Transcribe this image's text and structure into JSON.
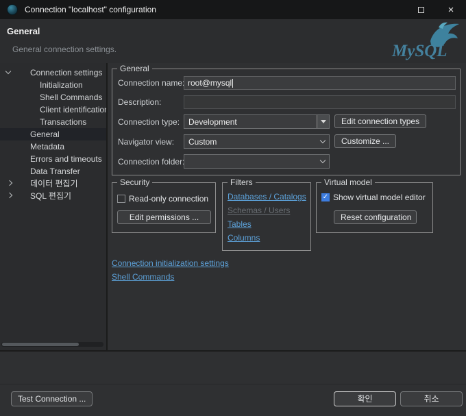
{
  "window": {
    "title": "Connection \"localhost\" configuration"
  },
  "header": {
    "title": "General",
    "subtitle": "General connection settings.",
    "logo_text": "MySQL"
  },
  "sidebar": {
    "items": [
      {
        "label": "Connection settings",
        "level": 0,
        "expanded": true
      },
      {
        "label": "Initialization",
        "level": 1
      },
      {
        "label": "Shell Commands",
        "level": 1
      },
      {
        "label": "Client identification",
        "level": 1
      },
      {
        "label": "Transactions",
        "level": 1
      },
      {
        "label": "General",
        "level": 0,
        "selected": true
      },
      {
        "label": "Metadata",
        "level": 0
      },
      {
        "label": "Errors and timeouts",
        "level": 0
      },
      {
        "label": "Data Transfer",
        "level": 0
      },
      {
        "label": "데이터 편집기",
        "level": 0,
        "collapsed": true
      },
      {
        "label": "SQL 편집기",
        "level": 0,
        "collapsed": true
      }
    ]
  },
  "general_group": {
    "title": "General",
    "connection_name_label": "Connection name:",
    "connection_name_value": "root@mysql",
    "description_label": "Description:",
    "description_value": "",
    "connection_type_label": "Connection type:",
    "connection_type_value": "Development",
    "edit_connection_types_button": "Edit connection types",
    "navigator_view_label": "Navigator view:",
    "navigator_view_value": "Custom",
    "customize_button": "Customize ...",
    "connection_folder_label": "Connection folder:",
    "connection_folder_value": ""
  },
  "security_group": {
    "title": "Security",
    "readonly_label": "Read-only connection",
    "readonly_checked": false,
    "edit_permissions_button": "Edit permissions ..."
  },
  "filters_group": {
    "title": "Filters",
    "links": [
      {
        "label": "Databases / Catalogs",
        "enabled": true
      },
      {
        "label": "Schemas / Users",
        "enabled": false
      },
      {
        "label": "Tables",
        "enabled": true
      },
      {
        "label": "Columns",
        "enabled": true
      }
    ]
  },
  "virtual_model_group": {
    "title": "Virtual model",
    "show_editor_label": "Show virtual model editor",
    "show_editor_checked": true,
    "reset_button": "Reset configuration"
  },
  "links": {
    "init_settings": "Connection initialization settings",
    "shell_commands": "Shell Commands"
  },
  "footer": {
    "test_connection_button": "Test Connection ...",
    "ok_button": "확인",
    "cancel_button": "취소"
  },
  "colors": {
    "link": "#5da2da",
    "checkbox_accent": "#3d7de0",
    "selection": "#212328",
    "logo_teal": "#44819e"
  }
}
